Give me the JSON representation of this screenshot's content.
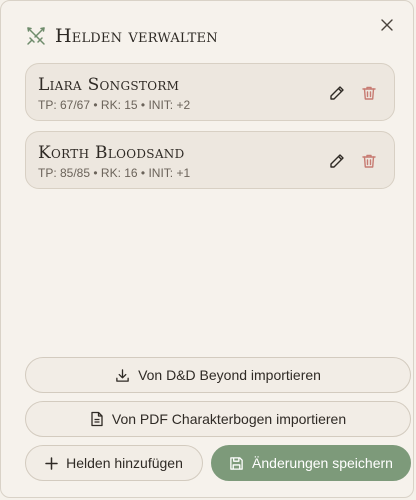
{
  "dialog": {
    "title": "Helden verwalten"
  },
  "heroes": [
    {
      "name": "Liara Songstorm",
      "stats": "TP: 67/67 • RK: 15 • INIT: +2"
    },
    {
      "name": "Korth Bloodsand",
      "stats": "TP: 85/85 • RK: 16 • INIT: +1"
    }
  ],
  "actions": {
    "import_dndbeyond": "Von D&D Beyond importieren",
    "import_pdf": "Von PDF Charakterbogen importieren",
    "add_hero": "Helden hinzufügen",
    "save_changes": "Änderungen speichern"
  },
  "icons": {
    "header": "crossed-swords-icon",
    "close": "close-icon",
    "edit": "pencil-icon",
    "delete": "trash-icon",
    "download": "download-icon",
    "document": "document-icon",
    "plus": "plus-icon",
    "save": "save-icon"
  },
  "colors": {
    "accent_green": "#7d9a7a",
    "delete_red": "#c77b72",
    "background": "#f6f2ec",
    "card": "#ede7df"
  }
}
